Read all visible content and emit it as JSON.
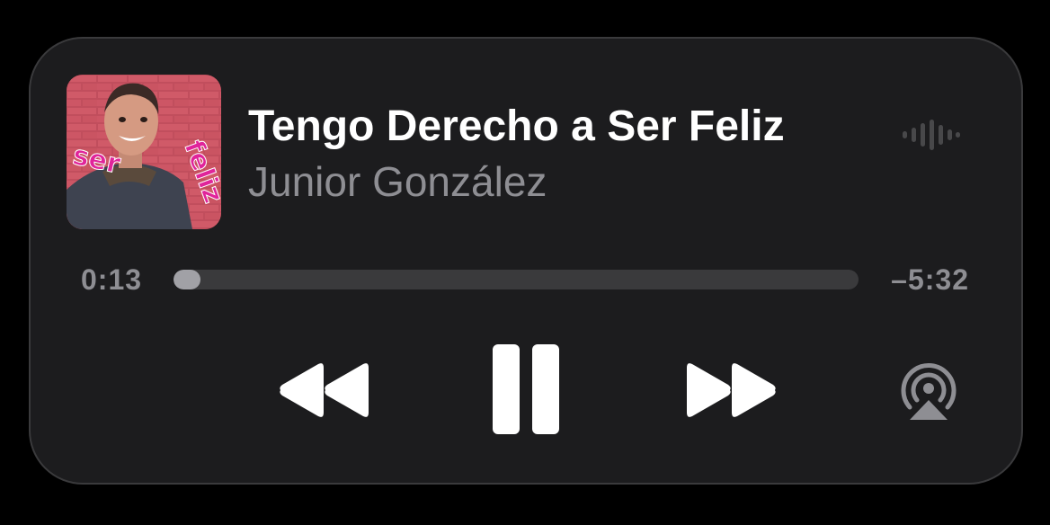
{
  "now_playing": {
    "title": "Tengo Derecho a Ser Feliz",
    "artist": "Junior González",
    "artwork_text": [
      "ser",
      "feliz"
    ]
  },
  "progress": {
    "elapsed": "0:13",
    "remaining": "–5:32",
    "fraction": 0.039
  },
  "controls": {
    "rewind_icon": "rewind-icon",
    "pause_icon": "pause-icon",
    "forward_icon": "fast-forward-icon",
    "airplay_icon": "airplay-icon",
    "waveform_icon": "waveform-icon"
  },
  "colors": {
    "background": "#000000",
    "panel": "#1c1c1e",
    "primary_text": "#ffffff",
    "secondary_text": "#8e8e93",
    "track": "#3a3a3c",
    "track_fill": "#a1a1a6",
    "artwork_text": "#e0249a"
  }
}
